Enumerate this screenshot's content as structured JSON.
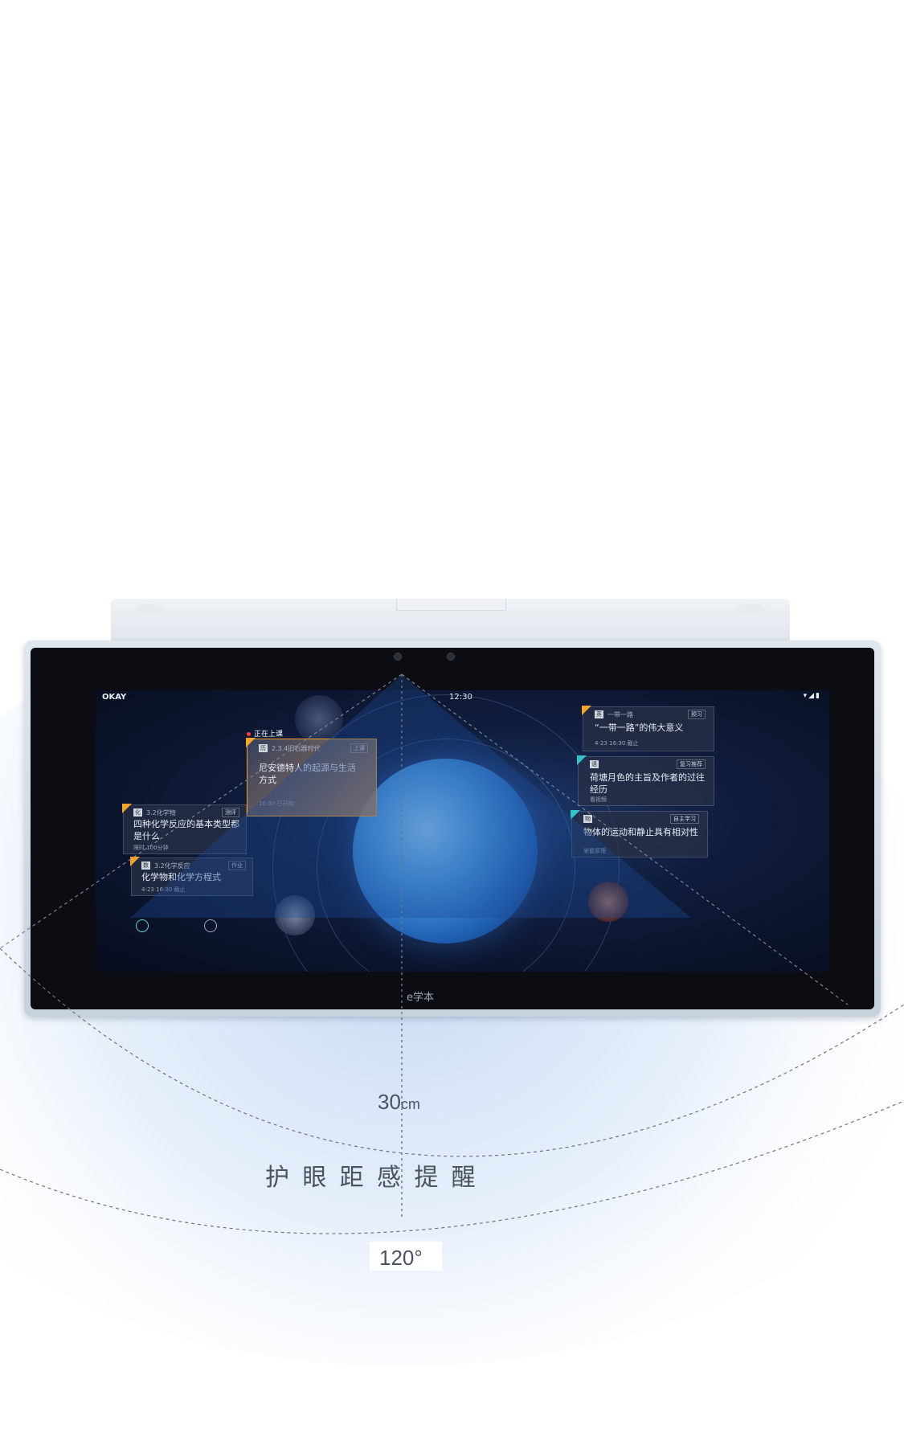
{
  "tablet": {
    "brand": "e学本",
    "status_left": "OKAY",
    "status_time": "12:30",
    "status_icons": "▾◢▮"
  },
  "now_label": "正在上课",
  "cards": {
    "current": {
      "subject": "历",
      "code": "2.3.4旧石器时代",
      "tag": "上课",
      "title": "尼安德特人的起源与生活方式",
      "foot": "16:30 已开始"
    },
    "left1": {
      "subject": "化",
      "code": "3.2化学物",
      "tag": "测评",
      "title": "四种化学反应的基本类型都是什么",
      "foot": "限时 100分钟"
    },
    "left2": {
      "subject": "数",
      "code": "3.2化学反应",
      "tag": "作业",
      "title": "化学物和化学方程式",
      "foot": "4-23  16:30 截止"
    },
    "right1": {
      "subject": "英",
      "code": "一带一路",
      "tag": "预习",
      "title": "“一带一路”的伟大意义",
      "foot": "4-23  16:30 截止"
    },
    "right2": {
      "subject": "语",
      "code": "",
      "tag": "复习推荐",
      "title": "荷塘月色的主旨及作者的过往经历",
      "foot": "看视频"
    },
    "right3": {
      "subject": "物",
      "code": "",
      "tag": "自主学习",
      "title": "物体的运动和静止具有相对性",
      "foot": "掌握原理"
    }
  },
  "measure": {
    "distance_value": "30",
    "distance_unit": "cm",
    "feature_title": "护 眼 距 感 提 醒",
    "angle": "120°"
  },
  "colors": {
    "accent_orange": "#f2a32c",
    "dashed_line": "#6f7480",
    "zone_blue": "#c9dcf5"
  }
}
